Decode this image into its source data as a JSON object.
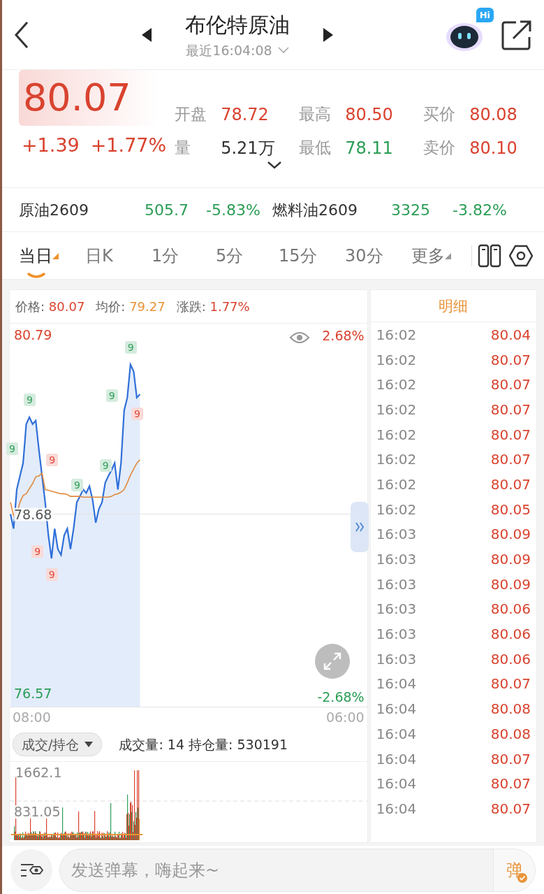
{
  "header": {
    "title": "布伦特原油",
    "subtitle": "最近16:04:08",
    "badge": "Hi"
  },
  "quote": {
    "price": "80.07",
    "change": "+1.39",
    "change_pct": "+1.77%",
    "stats": [
      {
        "label": "开盘",
        "value": "78.72",
        "color": "#d9432f"
      },
      {
        "label": "最高",
        "value": "80.50",
        "color": "#d9432f"
      },
      {
        "label": "买价",
        "value": "80.08",
        "color": "#d9432f"
      },
      {
        "label": "量",
        "value": "5.21万",
        "color": "#333333"
      },
      {
        "label": "最低",
        "value": "78.11",
        "color": "#2a9d55"
      },
      {
        "label": "卖价",
        "value": "80.10",
        "color": "#d9432f"
      }
    ]
  },
  "related": [
    {
      "name": "原油2609",
      "price": "505.7",
      "change": "-5.83%",
      "color": "#2a9d55"
    },
    {
      "name": "燃料油2609",
      "price": "3325",
      "change": "-3.82%",
      "color": "#2a9d55"
    }
  ],
  "tabs": [
    {
      "label": "当日",
      "selected": true,
      "has_menu": true
    },
    {
      "label": "日K",
      "selected": false,
      "has_menu": false
    },
    {
      "label": "1分",
      "selected": false,
      "has_menu": false
    },
    {
      "label": "5分",
      "selected": false,
      "has_menu": false
    },
    {
      "label": "15分",
      "selected": false,
      "has_menu": false
    },
    {
      "label": "30分",
      "selected": false,
      "has_menu": false
    },
    {
      "label": "更多",
      "selected": false,
      "has_menu": true
    }
  ],
  "chart_info": [
    {
      "label": "价格:",
      "value": "80.07",
      "color": "#d9432f"
    },
    {
      "label": "均价:",
      "value": "79.27",
      "color": "#e8943a"
    },
    {
      "label": "涨跌:",
      "value": "1.77%",
      "color": "#d9432f"
    }
  ],
  "price_chart": {
    "top_pct": "2.68%",
    "bottom_pct": "-2.68%",
    "start_time": "08:00",
    "end_time": "06:00",
    "chart_data": {
      "type": "line",
      "ylim": [
        74.83,
        81.34
      ],
      "yticks": [
        80.79,
        78.68,
        76.57
      ],
      "categories": [
        null,
        null,
        null,
        null,
        null,
        null,
        null,
        null,
        null,
        null,
        null,
        null,
        null,
        null,
        null,
        null,
        null,
        null,
        null,
        null,
        null,
        null,
        null,
        null,
        null,
        null,
        null,
        null,
        null,
        null,
        null,
        null,
        null,
        null,
        null,
        null,
        null,
        null,
        null,
        null,
        null,
        null,
        null,
        null,
        null,
        null,
        null,
        null,
        null,
        null,
        null,
        null,
        null,
        null,
        null,
        null,
        null,
        null,
        null,
        null,
        null,
        null,
        null,
        null,
        null,
        null,
        null,
        null,
        null,
        null,
        null,
        null,
        null,
        null,
        null,
        null,
        null,
        null,
        null,
        null,
        null,
        null,
        null,
        null,
        null,
        null,
        null,
        null,
        null,
        null,
        null,
        null,
        null,
        null,
        null,
        null,
        null,
        null,
        null,
        null,
        null,
        null,
        null,
        null,
        null,
        null,
        null,
        null,
        null,
        null,
        null,
        null,
        null,
        null
      ],
      "series": [
        {
          "color": "#2f6fd8",
          "values": [
            78.68,
            78.51,
            78.97,
            79.13,
            79.28,
            79.74,
            79.82,
            79.74,
            79.78,
            79.44,
            79.13,
            78.82,
            78.43,
            78.16,
            78.51,
            78.27,
            78.2,
            78.43,
            78.51,
            78.27,
            78.51,
            78.82,
            78.89,
            78.97,
            78.93,
            79.01,
            78.85,
            78.58,
            78.74,
            78.82,
            79.05,
            79.13,
            79.2,
            79.28,
            78.97,
            79.28,
            79.9,
            80.05,
            80.44,
            80.36,
            80.05,
            80.09,
            null,
            null,
            null,
            null,
            null,
            null,
            null,
            null,
            null,
            null,
            null,
            null,
            null,
            null,
            null,
            null,
            null,
            null,
            null,
            null,
            null,
            null,
            null,
            null,
            null,
            null,
            null,
            null,
            null,
            null,
            null,
            null,
            null,
            null,
            null,
            null,
            null,
            null,
            null,
            null,
            null,
            null,
            null,
            null,
            null,
            null,
            null,
            null,
            null,
            null,
            null,
            null,
            null,
            null,
            null,
            null,
            null,
            null,
            null,
            null,
            null,
            null,
            null,
            null,
            null,
            null,
            null,
            null,
            null,
            null,
            null,
            null
          ]
        },
        {
          "color": "#e0893c",
          "values": [
            78.82,
            78.66,
            78.69,
            78.82,
            78.9,
            78.92,
            78.98,
            79.04,
            79.12,
            79.13,
            79.16,
            78.97,
            78.96,
            78.95,
            78.94,
            78.93,
            78.92,
            78.92,
            78.91,
            78.89,
            78.89,
            78.89,
            78.89,
            78.88,
            78.88,
            78.88,
            78.88,
            78.88,
            78.88,
            78.88,
            78.88,
            78.88,
            78.89,
            78.91,
            78.92,
            78.94,
            78.97,
            79.05,
            79.14,
            79.21,
            79.28,
            79.32,
            null,
            null,
            null,
            null,
            null,
            null,
            null,
            null,
            null,
            null,
            null,
            null,
            null,
            null,
            null,
            null,
            null,
            null,
            null,
            null,
            null,
            null,
            null,
            null,
            null,
            null,
            null,
            null,
            null,
            null,
            null,
            null,
            null,
            null,
            null,
            null,
            null,
            null,
            null,
            null,
            null,
            null,
            null,
            null,
            null,
            null,
            null,
            null,
            null,
            null,
            null,
            null,
            null,
            null,
            null,
            null,
            null,
            null,
            null,
            null,
            null,
            null,
            null,
            null,
            null,
            null,
            null,
            null,
            null,
            null,
            null,
            null
          ]
        }
      ]
    },
    "markers": [
      {
        "label": "9",
        "color": "#2f9e5a"
      },
      {
        "label": "9",
        "color": "#2f9e5a"
      },
      {
        "label": "9",
        "color": "#2f9e5a"
      },
      {
        "label": "9",
        "color": "#2f9e5a"
      },
      {
        "label": "9",
        "color": "#2f9e5a"
      },
      {
        "label": "9",
        "color": "#2f9e5a"
      },
      {
        "label": "9",
        "color": "#e0483a"
      },
      {
        "label": "9",
        "color": "#e0483a"
      },
      {
        "label": "9",
        "color": "#e0483a"
      },
      {
        "label": "9",
        "color": "#e0483a"
      }
    ]
  },
  "volume": {
    "selector": "成交/持仓",
    "summary": "成交量: 14 持仓量: 530191",
    "max": "1662.1",
    "mid": "831.05"
  },
  "detail": {
    "title": "明细",
    "rows": [
      {
        "time": "16:02",
        "price": "80.04"
      },
      {
        "time": "16:02",
        "price": "80.07"
      },
      {
        "time": "16:02",
        "price": "80.07"
      },
      {
        "time": "16:02",
        "price": "80.07"
      },
      {
        "time": "16:02",
        "price": "80.07"
      },
      {
        "time": "16:02",
        "price": "80.07"
      },
      {
        "time": "16:02",
        "price": "80.07"
      },
      {
        "time": "16:02",
        "price": "80.05"
      },
      {
        "time": "16:03",
        "price": "80.09"
      },
      {
        "time": "16:03",
        "price": "80.09"
      },
      {
        "time": "16:03",
        "price": "80.09"
      },
      {
        "time": "16:03",
        "price": "80.06"
      },
      {
        "time": "16:03",
        "price": "80.06"
      },
      {
        "time": "16:03",
        "price": "80.06"
      },
      {
        "time": "16:04",
        "price": "80.07"
      },
      {
        "time": "16:04",
        "price": "80.08"
      },
      {
        "time": "16:04",
        "price": "80.08"
      },
      {
        "time": "16:04",
        "price": "80.07"
      },
      {
        "time": "16:04",
        "price": "80.07"
      },
      {
        "time": "16:04",
        "price": "80.07"
      }
    ]
  },
  "input": {
    "placeholder": "发送弹幕，嗨起来~",
    "send_label": "弹"
  }
}
